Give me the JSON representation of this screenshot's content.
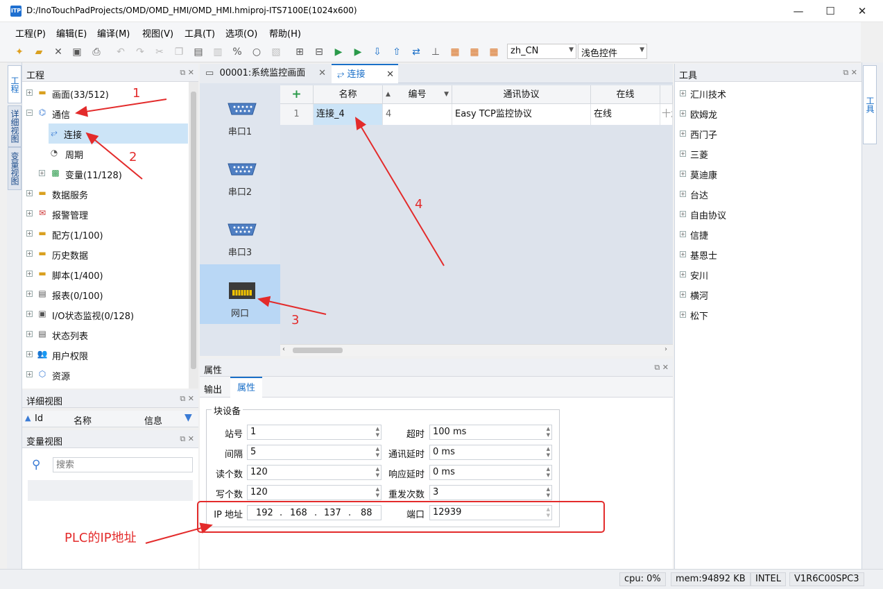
{
  "window": {
    "title": "D:/InoTouchPadProjects/OMD/OMD_HMI/OMD_HMI.hmiproj-ITS7100E(1024x600)",
    "logo": "ITP"
  },
  "menu": [
    "工程(P)",
    "编辑(E)",
    "编译(M)",
    "视图(V)",
    "工具(T)",
    "选项(O)",
    "帮助(H)"
  ],
  "toolbar": {
    "language": "zh_CN",
    "theme": "浅色控件"
  },
  "left_tabs": [
    "工程",
    "详细视图",
    "变量视图"
  ],
  "project_panel": {
    "title": "工程",
    "tree": [
      {
        "label": "画面(33/512)"
      },
      {
        "label": "通信"
      },
      {
        "label": "连接"
      },
      {
        "label": "周期"
      },
      {
        "label": "变量(11/128)"
      },
      {
        "label": "数据服务"
      },
      {
        "label": "报警管理"
      },
      {
        "label": "配方(1/100)"
      },
      {
        "label": "历史数据"
      },
      {
        "label": "脚本(1/400)"
      },
      {
        "label": "报表(0/100)"
      },
      {
        "label": "I/O状态监视(0/128)"
      },
      {
        "label": "状态列表"
      },
      {
        "label": "用户权限"
      },
      {
        "label": "资源"
      }
    ]
  },
  "detail_panel": {
    "title": "详细视图",
    "cols": [
      "Id",
      "名称",
      "信息"
    ]
  },
  "var_panel": {
    "title": "变量视图",
    "search_placeholder": "搜索"
  },
  "tabs": [
    {
      "label": "00001:系统监控画面"
    },
    {
      "label": "连接"
    }
  ],
  "devices": [
    "串口1",
    "串口2",
    "串口3",
    "网口"
  ],
  "grid": {
    "headers": [
      "名称",
      "编号",
      "通讯协议",
      "在线"
    ],
    "row": {
      "index": "1",
      "name": "连接_4",
      "id": "4",
      "protocol": "Easy TCP监控协议",
      "online": "在线",
      "more": "十六"
    }
  },
  "props": {
    "title": "属性",
    "tabs": [
      "输出",
      "属性"
    ],
    "group": "块设备",
    "fields_left": [
      {
        "label": "站号",
        "value": "1"
      },
      {
        "label": "间隔",
        "value": "5"
      },
      {
        "label": "读个数",
        "value": "120"
      },
      {
        "label": "写个数",
        "value": "120"
      }
    ],
    "fields_right": [
      {
        "label": "超时",
        "value": "100 ms"
      },
      {
        "label": "通讯延时",
        "value": "0 ms"
      },
      {
        "label": "响应延时",
        "value": "0 ms"
      },
      {
        "label": "重发次数",
        "value": "3"
      }
    ],
    "ip_label": "IP 地址",
    "ip": [
      "192",
      "168",
      "137",
      "88"
    ],
    "port_label": "端口",
    "port": "12939"
  },
  "tools_panel": {
    "title": "工具",
    "items": [
      "汇川技术",
      "欧姆龙",
      "西门子",
      "三菱",
      "莫迪康",
      "台达",
      "自由协议",
      "信捷",
      "基恩士",
      "安川",
      "横河",
      "松下"
    ],
    "side_tab": "工具"
  },
  "status": {
    "cpu": "cpu:  0%",
    "mem": "mem:94892 KB",
    "arch": "INTEL",
    "version": "V1R6C00SPC3"
  },
  "annotations": {
    "n1": "1",
    "n2": "2",
    "n3": "3",
    "n4": "4",
    "plc": "PLC的IP地址"
  }
}
